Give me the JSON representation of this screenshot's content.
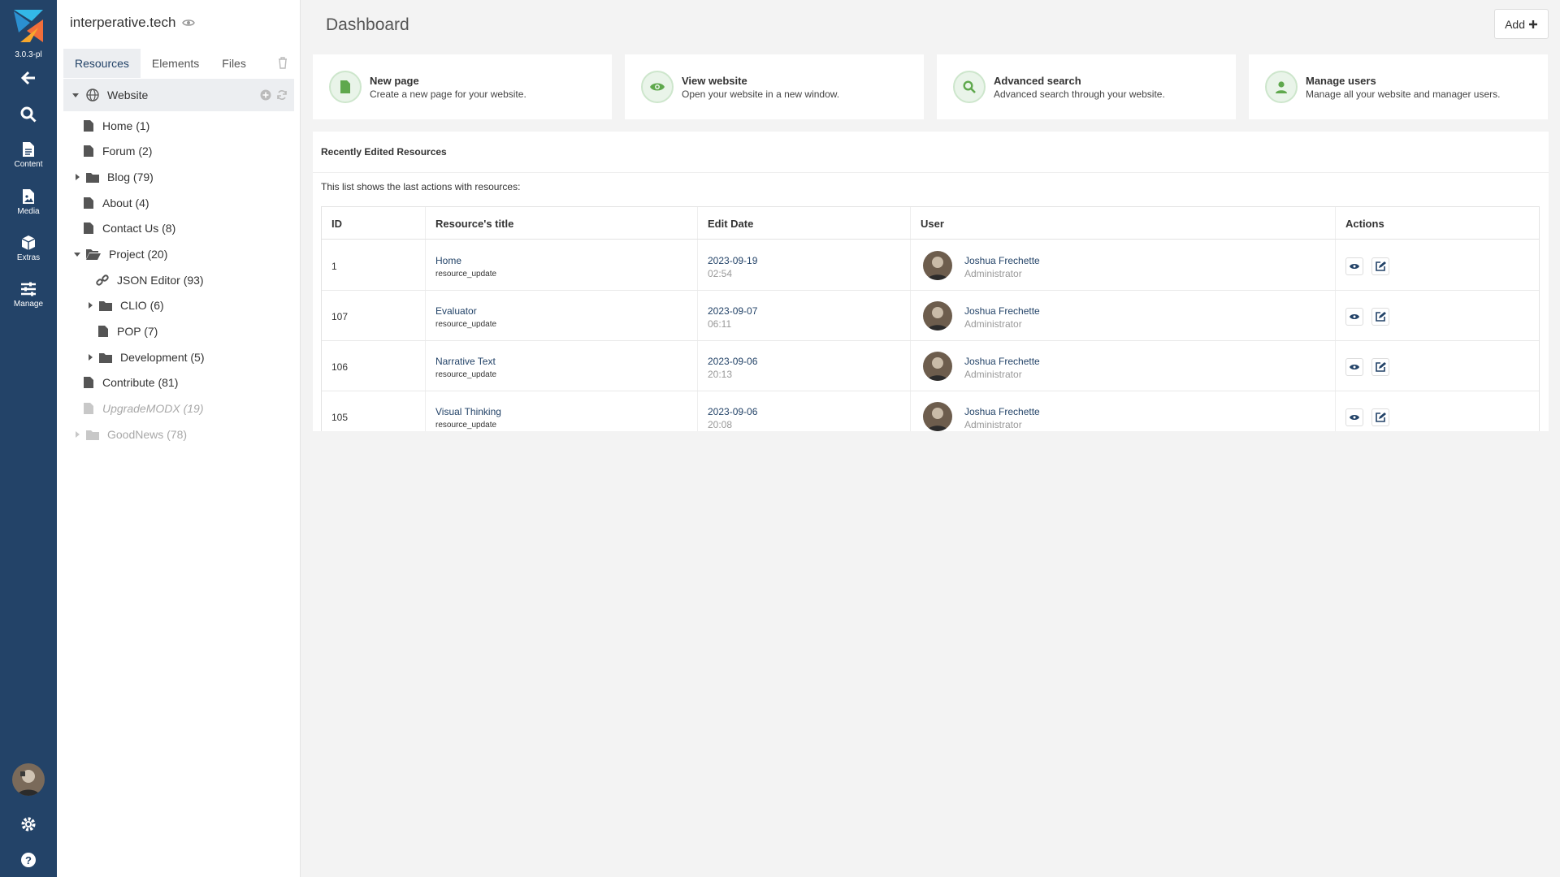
{
  "app": {
    "version": "3.0.3-pl",
    "site_name": "interperative.tech"
  },
  "rail": {
    "items": [
      {
        "label": "",
        "icon": "back-arrow-icon"
      },
      {
        "label": "",
        "icon": "search-icon"
      },
      {
        "label": "Content",
        "icon": "document-icon"
      },
      {
        "label": "Media",
        "icon": "image-file-icon"
      },
      {
        "label": "Extras",
        "icon": "cube-icon"
      },
      {
        "label": "Manage",
        "icon": "sliders-icon"
      }
    ]
  },
  "tree": {
    "tabs": [
      "Resources",
      "Elements",
      "Files"
    ],
    "root": "Website",
    "nodes": [
      {
        "label": "Home (1)"
      },
      {
        "label": "Forum (2)"
      },
      {
        "label": "Blog (79)"
      },
      {
        "label": "About (4)"
      },
      {
        "label": "Contact Us (8)"
      },
      {
        "label": "Project (20)"
      },
      {
        "label": "JSON Editor (93)"
      },
      {
        "label": "CLIO (6)"
      },
      {
        "label": "POP (7)"
      },
      {
        "label": "Development (5)"
      },
      {
        "label": "Contribute (81)"
      },
      {
        "label": "UpgradeMODX (19)"
      },
      {
        "label": "GoodNews (78)"
      }
    ]
  },
  "main": {
    "title": "Dashboard",
    "add_label": "Add",
    "quick_actions": [
      {
        "title": "New page",
        "desc": "Create a new page for your website."
      },
      {
        "title": "View website",
        "desc": "Open your website in a new window."
      },
      {
        "title": "Advanced search",
        "desc": "Advanced search through your website."
      },
      {
        "title": "Manage users",
        "desc": "Manage all your website and manager users."
      }
    ],
    "recent": {
      "heading": "Recently Edited Resources",
      "desc": "This list shows the last actions with resources:",
      "columns": [
        "ID",
        "Resource's title",
        "Edit Date",
        "User",
        "Actions"
      ],
      "rows": [
        {
          "id": "1",
          "title": "Home",
          "action": "resource_update",
          "date": "2023-09-19",
          "time": "02:54",
          "user": "Joshua Frechette",
          "role": "Administrator"
        },
        {
          "id": "107",
          "title": "Evaluator",
          "action": "resource_update",
          "date": "2023-09-07",
          "time": "06:11",
          "user": "Joshua Frechette",
          "role": "Administrator"
        },
        {
          "id": "106",
          "title": "Narrative Text",
          "action": "resource_update",
          "date": "2023-09-06",
          "time": "20:13",
          "user": "Joshua Frechette",
          "role": "Administrator"
        },
        {
          "id": "105",
          "title": "Visual Thinking",
          "action": "resource_update",
          "date": "2023-09-06",
          "time": "20:08",
          "user": "Joshua Frechette",
          "role": "Administrator"
        }
      ]
    }
  },
  "colors": {
    "rail": "#234368",
    "accent": "#5fa84d",
    "link": "#234368"
  }
}
